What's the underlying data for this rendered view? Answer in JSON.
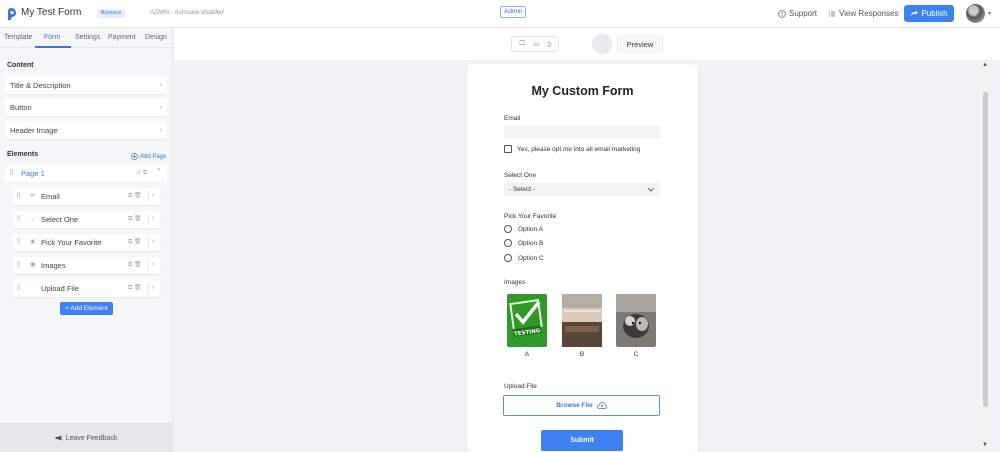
{
  "header": {
    "app_title": "My Test Form",
    "plan_badge": "Business",
    "admin_status": "ADMIN - Autosave disabled",
    "admin_pill": "Admin",
    "support_label": "Support",
    "view_responses_label": "View Responses",
    "publish_label": "Publish"
  },
  "sidebar": {
    "tabs": [
      {
        "label": "Template"
      },
      {
        "label": "Form",
        "active": true
      },
      {
        "label": "Settings"
      },
      {
        "label": "Payment"
      },
      {
        "label": "Design"
      }
    ],
    "content_heading": "Content",
    "content_items": [
      {
        "label": "Title & Description"
      },
      {
        "label": "Button"
      },
      {
        "label": "Header Image"
      }
    ],
    "elements_heading": "Elements",
    "add_page_label": "Add Page",
    "page_label": "Page 1",
    "elements": [
      {
        "label": "Email",
        "icon": "envelope-icon"
      },
      {
        "label": "Select One",
        "icon": "dropdown-icon"
      },
      {
        "label": "Pick Your Favorite",
        "icon": "radio-icon"
      },
      {
        "label": "Images",
        "icon": "image-icon"
      },
      {
        "label": "Upload File",
        "icon": "upload-icon"
      }
    ],
    "add_element_label": "+ Add Element",
    "leave_feedback_label": "Leave Feedback"
  },
  "preview_bar": {
    "preview_label": "Preview"
  },
  "form": {
    "title": "My Custom Form",
    "email_label": "Email",
    "email_value": "",
    "opt_in_label": "Yes, please opt me into all email marketing",
    "select_label": "Select One",
    "select_value": "- Select -",
    "favorite_label": "Pick Your Favorite",
    "options": [
      "Option A",
      "Option B",
      "Option C"
    ],
    "images_label": "Images",
    "image_captions": [
      "A",
      "B",
      "C"
    ],
    "image_a_text": "TESTING",
    "upload_label": "Upload File",
    "browse_label": "Browse File",
    "submit_label": "Submit"
  },
  "colors": {
    "accent": "#3c82f0",
    "accent_text": "#3a76d8"
  }
}
